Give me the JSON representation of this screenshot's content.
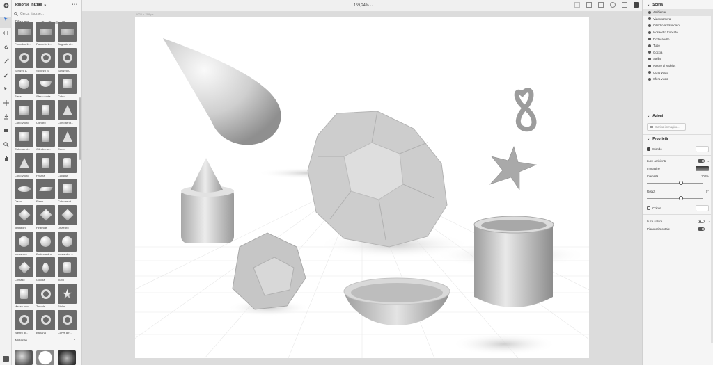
{
  "left_panel": {
    "title": "Risorse iniziali",
    "menu_dots": "•••",
    "search_placeholder": "Cerca risorse...",
    "filter_label": "Filtra per",
    "assets": [
      {
        "label": "Pomeliza li..."
      },
      {
        "label": "Pannello L..."
      },
      {
        "label": "Segnale di..."
      },
      {
        "label": "Schizzo A"
      },
      {
        "label": "Schizzo B"
      },
      {
        "label": "Schizzo C"
      },
      {
        "label": "Sfera"
      },
      {
        "label": "Sfera vuota"
      },
      {
        "label": "Cubo"
      },
      {
        "label": "Cubo vuoto"
      },
      {
        "label": "Cilindro"
      },
      {
        "label": "Cono arrot..."
      },
      {
        "label": "Cubo arrot..."
      },
      {
        "label": "Cilindro ar..."
      },
      {
        "label": "Cono"
      },
      {
        "label": "Cono vuoto"
      },
      {
        "label": "Prisma"
      },
      {
        "label": "Capsula"
      },
      {
        "label": "Disco"
      },
      {
        "label": "Piano"
      },
      {
        "label": "Cubo arrot..."
      },
      {
        "label": "Tetraedro"
      },
      {
        "label": "Piramide"
      },
      {
        "label": "Ottaedro"
      },
      {
        "label": "Icosaedro"
      },
      {
        "label": "Dodecaedro"
      },
      {
        "label": "Icosaedro ..."
      },
      {
        "label": "Cristallo"
      },
      {
        "label": "Goccia"
      },
      {
        "label": "Tubo"
      },
      {
        "label": "Mezzo tubo"
      },
      {
        "label": "Toroide"
      },
      {
        "label": "Stella"
      },
      {
        "label": "Nastro di..."
      },
      {
        "label": "Banana"
      },
      {
        "label": "Curve arr..."
      }
    ],
    "materials_label": "Materiali"
  },
  "topbar": {
    "zoom": "159,24%"
  },
  "canvas": {
    "doc_size": "1024 × 768 px"
  },
  "right_panel": {
    "scene_title": "Scena",
    "scene_items": [
      {
        "label": "Ambiente",
        "selected": true
      },
      {
        "label": "Videocamera"
      },
      {
        "label": "Cilindro arrotondato"
      },
      {
        "label": "Icosaedro troncato"
      },
      {
        "label": "Dodecaedro"
      },
      {
        "label": "Tubo"
      },
      {
        "label": "Goccia"
      },
      {
        "label": "Stella"
      },
      {
        "label": "Nastro di Möbius"
      },
      {
        "label": "Cono vuoto"
      },
      {
        "label": "Sfera vuota"
      }
    ],
    "actions_title": "Azioni",
    "load_image_button": "Carica immagine...",
    "properties_title": "Proprietà",
    "background_label": "Sfondo",
    "ambient_light_label": "Luce ambiente",
    "image_label": "Immagine",
    "intensity_label": "Intensità",
    "intensity_value": "100%",
    "intensity_fraction": 0.6,
    "rotation_label": "Rotaz.",
    "rotation_value": "0°",
    "rotation_fraction": 0.6,
    "color_label": "Colore",
    "sun_light_label": "Luce solare",
    "ground_plane_label": "Piano orizzontale"
  }
}
